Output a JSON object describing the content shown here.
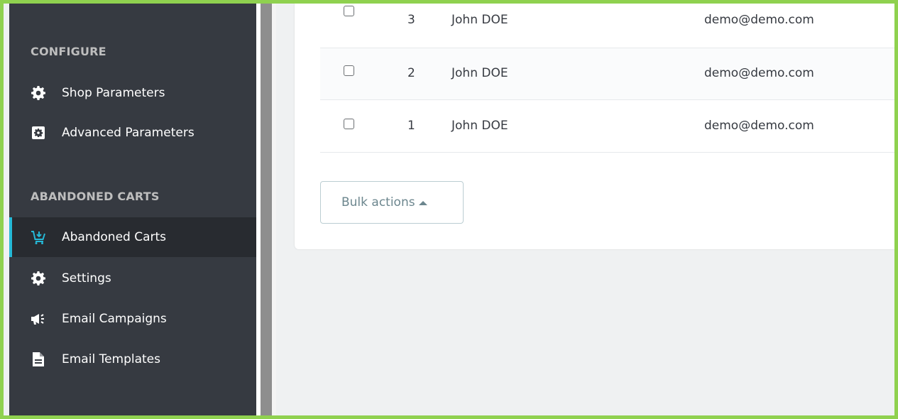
{
  "sidebar": {
    "configure_title": "CONFIGURE",
    "configure_items": [
      {
        "label": "Shop Parameters",
        "icon": "gear-icon"
      },
      {
        "label": "Advanced Parameters",
        "icon": "gear-box-icon"
      }
    ],
    "abandoned_title": "ABANDONED CARTS",
    "abandoned_items": [
      {
        "label": "Abandoned Carts",
        "icon": "cart-add-icon",
        "active": true
      },
      {
        "label": "Settings",
        "icon": "gear-icon"
      },
      {
        "label": "Email Campaigns",
        "icon": "megaphone-icon"
      },
      {
        "label": "Email Templates",
        "icon": "document-icon"
      }
    ]
  },
  "table": {
    "rows": [
      {
        "id": "3",
        "name": "John DOE",
        "email": "demo@demo.com"
      },
      {
        "id": "2",
        "name": "John DOE",
        "email": "demo@demo.com"
      },
      {
        "id": "1",
        "name": "John DOE",
        "email": "demo@demo.com"
      }
    ]
  },
  "bulk_actions": {
    "label": "Bulk actions"
  },
  "colors": {
    "sidebar_bg": "#363a41",
    "active_accent": "#25b9d7",
    "frame_border": "#8fd14f"
  }
}
